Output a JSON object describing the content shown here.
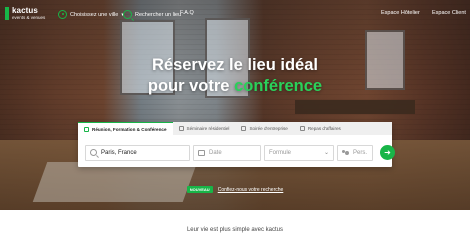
{
  "brand": {
    "name": "kactus",
    "subtitle": "events & venues",
    "accent_color": "#18b548"
  },
  "nav": {
    "city_selector": "Choisissez une ville",
    "search_venue": "Rechercher un lieu",
    "faq": "F.A.Q",
    "owner_space": "Espace Hôtelier",
    "client_space": "Espace Client"
  },
  "hero": {
    "line1": "Réservez le lieu idéal",
    "line2_prefix": "pour votre ",
    "line2_accent": "conférence"
  },
  "search": {
    "tabs": [
      {
        "label": "Réunion, Formation & Conférence",
        "active": true
      },
      {
        "label": "Séminaire résidentiel",
        "active": false
      },
      {
        "label": "Soirée d'entreprise",
        "active": false
      },
      {
        "label": "Repas d'affaires",
        "active": false
      }
    ],
    "place_value": "Paris, France",
    "date_placeholder": "Date",
    "formule_placeholder": "Formule",
    "pers_placeholder": "Pers.",
    "submit_icon": "arrow-right-icon"
  },
  "promo": {
    "badge": "NOUVEAU",
    "link": "Confiez-nous votre recherche"
  },
  "tagline": "Leur vie est plus simple avec kactus"
}
